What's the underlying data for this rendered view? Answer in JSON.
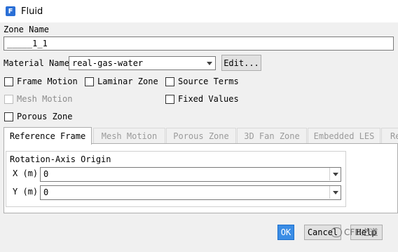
{
  "window": {
    "title": "Fluid",
    "icon": "fluent-app-icon"
  },
  "zone_name": {
    "label": "Zone Name",
    "value": "_____1_1"
  },
  "material": {
    "label": "Material Name",
    "value": "real-gas-water",
    "edit_label": "Edit..."
  },
  "checkboxes": {
    "frame_motion": {
      "label": "Frame Motion",
      "checked": false
    },
    "laminar_zone": {
      "label": "Laminar Zone",
      "checked": false
    },
    "source_terms": {
      "label": "Source Terms",
      "checked": false
    },
    "mesh_motion": {
      "label": "Mesh Motion",
      "checked": false,
      "enabled": false
    },
    "fixed_values": {
      "label": "Fixed Values",
      "checked": false
    },
    "porous_zone": {
      "label": "Porous Zone",
      "checked": false
    }
  },
  "tabs": [
    {
      "label": "Reference Frame",
      "active": true
    },
    {
      "label": "Mesh Motion",
      "active": false
    },
    {
      "label": "Porous Zone",
      "active": false
    },
    {
      "label": "3D Fan Zone",
      "active": false
    },
    {
      "label": "Embedded LES",
      "active": false
    },
    {
      "label": "Re",
      "active": false
    }
  ],
  "rotation_axis_origin": {
    "title": "Rotation-Axis Origin",
    "x": {
      "label": "X (m)",
      "value": "0"
    },
    "y": {
      "label": "Y (m)",
      "value": "0"
    }
  },
  "buttons": {
    "ok": "OK",
    "cancel": "Cancel",
    "help": "Help"
  },
  "watermark": "CFD之道",
  "colors": {
    "accent": "#3b8de5",
    "window_bg": "#f0f0f0"
  }
}
